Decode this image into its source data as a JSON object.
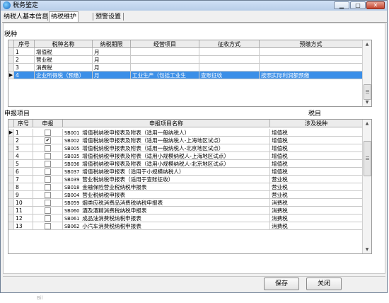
{
  "window": {
    "title": "税务鉴定"
  },
  "tabs": [
    {
      "label": "纳税人基本信息",
      "active": false
    },
    {
      "label": "纳税维护",
      "active": true
    },
    {
      "label": "预警设置",
      "active": false
    }
  ],
  "tax_section": {
    "label": "税种",
    "columns": [
      "序号",
      "税种名称",
      "纳税期限",
      "经营项目",
      "征收方式",
      "预缴方式"
    ],
    "rows": [
      {
        "no": "1",
        "name": "增值税",
        "period": "月",
        "item": "",
        "method": "",
        "prepay": "",
        "selected": false
      },
      {
        "no": "2",
        "name": "营业税",
        "period": "月",
        "item": "",
        "method": "",
        "prepay": "",
        "selected": false
      },
      {
        "no": "3",
        "name": "消费税",
        "period": "月",
        "item": "",
        "method": "",
        "prepay": "",
        "selected": false
      },
      {
        "no": "4",
        "name": "企业所得税（预缴）",
        "period": "月",
        "item": "工业生产（包括工业生",
        "method": "查账征收",
        "prepay": "按照实际利润额预缴",
        "selected": true
      }
    ]
  },
  "declare_section": {
    "label": "申报项目",
    "right_label": "税目",
    "columns": [
      "序号",
      "申报",
      "申报项目名称",
      "涉及税种"
    ],
    "rows": [
      {
        "no": "1",
        "checked": false,
        "code": "SB001",
        "name": "增值税纳税申报表及附表（适用一般纳税人）",
        "tax": "增值税",
        "current": true
      },
      {
        "no": "2",
        "checked": true,
        "code": "SB002",
        "name": "增值税纳税申报表及附表（适用一般纳税人-上海地区试点）",
        "tax": "增值税",
        "current": false
      },
      {
        "no": "3",
        "checked": false,
        "code": "SB005",
        "name": "增值税纳税申报表及附表（适用一般纳税人-北京地区试点）",
        "tax": "增值税",
        "current": false
      },
      {
        "no": "4",
        "checked": false,
        "code": "SB035",
        "name": "增值税纳税申报表及附表（适用小规模纳税人-上海地区试点）",
        "tax": "增值税",
        "current": false
      },
      {
        "no": "5",
        "checked": false,
        "code": "SB036",
        "name": "增值税纳税申报表及附表（适用小规模纳税人-北京地区试点）",
        "tax": "增值税",
        "current": false
      },
      {
        "no": "6",
        "checked": false,
        "code": "SB037",
        "name": "增值税纳税申报表（适用于小规模纳税人）",
        "tax": "增值税",
        "current": false
      },
      {
        "no": "7",
        "checked": false,
        "code": "SB039",
        "name": "营业税纳税申报表（适用于查账征收）",
        "tax": "营业税",
        "current": false
      },
      {
        "no": "8",
        "checked": false,
        "code": "SB018",
        "name": "金融保险营业税纳税申报表",
        "tax": "营业税",
        "current": false
      },
      {
        "no": "9",
        "checked": false,
        "code": "SB004",
        "name": "营业税纳税申报表",
        "tax": "营业税",
        "current": false
      },
      {
        "no": "10",
        "checked": false,
        "code": "SB059",
        "name": "烟类应税消费品消费税纳税申报表",
        "tax": "消费税",
        "current": false
      },
      {
        "no": "11",
        "checked": false,
        "code": "SB060",
        "name": "酒及酒精消费税纳税申报表",
        "tax": "消费税",
        "current": false
      },
      {
        "no": "12",
        "checked": false,
        "code": "SB061",
        "name": "成品油消费税纳税申报表",
        "tax": "消费税",
        "current": false
      },
      {
        "no": "13",
        "checked": false,
        "code": "SB062",
        "name": "小汽车消费税纳税申报表",
        "tax": "消费税",
        "current": false
      }
    ]
  },
  "buttons": {
    "save": "保存",
    "close": "关闭"
  },
  "below_text": "Bil"
}
